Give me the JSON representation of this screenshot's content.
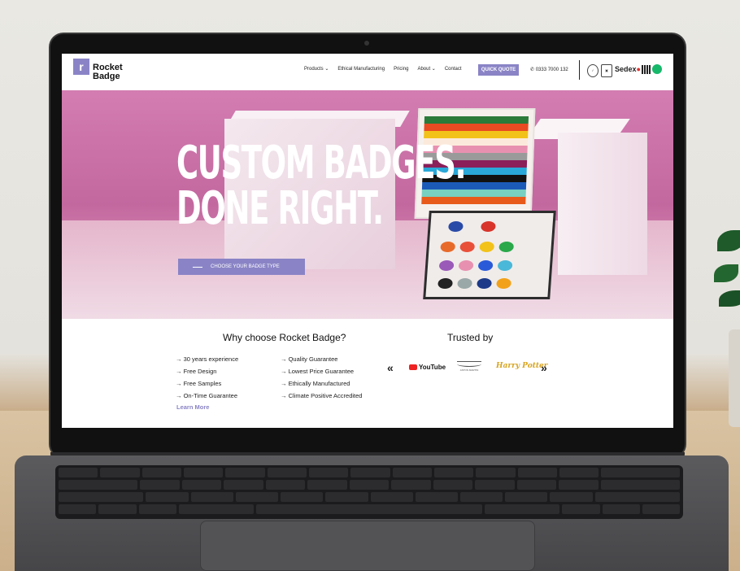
{
  "header": {
    "logo_mark": "r",
    "logo_line1": "Rocket",
    "logo_line2": "Badge",
    "nav": [
      {
        "label": "Products",
        "dropdown": true
      },
      {
        "label": "Ethical Manufacturing",
        "dropdown": false
      },
      {
        "label": "Pricing",
        "dropdown": false
      },
      {
        "label": "About",
        "dropdown": true
      },
      {
        "label": "Contact",
        "dropdown": false
      }
    ],
    "quote_button": "QUICK QUOTE",
    "phone": "0333 7000 132",
    "sedex_label": "Sedex",
    "phone_icon": "phone-icon",
    "chevron_icon": "chevron-down-icon"
  },
  "hero": {
    "headline_line1": "CUSTOM BADGES.",
    "headline_line2": "DONE RIGHT.",
    "cta_label": "CHOOSE YOUR BADGE TYPE"
  },
  "why": {
    "title": "Why choose Rocket Badge?",
    "col1": [
      "30 years experience",
      "Free Design",
      "Free Samples",
      "On-Time Guarantee"
    ],
    "col2": [
      "Quality Guarantee",
      "Lowest Price Guarantee",
      "Ethically Manufactured",
      "Climate Positive Accredited"
    ],
    "arrow_glyph": "→",
    "learn_more": "Learn More"
  },
  "trusted": {
    "title": "Trusted by",
    "logos": [
      "YouTube",
      "ASTON MARTIN",
      "Harry Potter"
    ],
    "prev_icon": "double-chevron-left-icon",
    "next_icon": "double-chevron-right-icon"
  },
  "colors": {
    "accent": "#8a84c6",
    "hero_pink": "#c96ca5",
    "sedex_red": "#e03030",
    "certified_green": "#18b86b"
  }
}
